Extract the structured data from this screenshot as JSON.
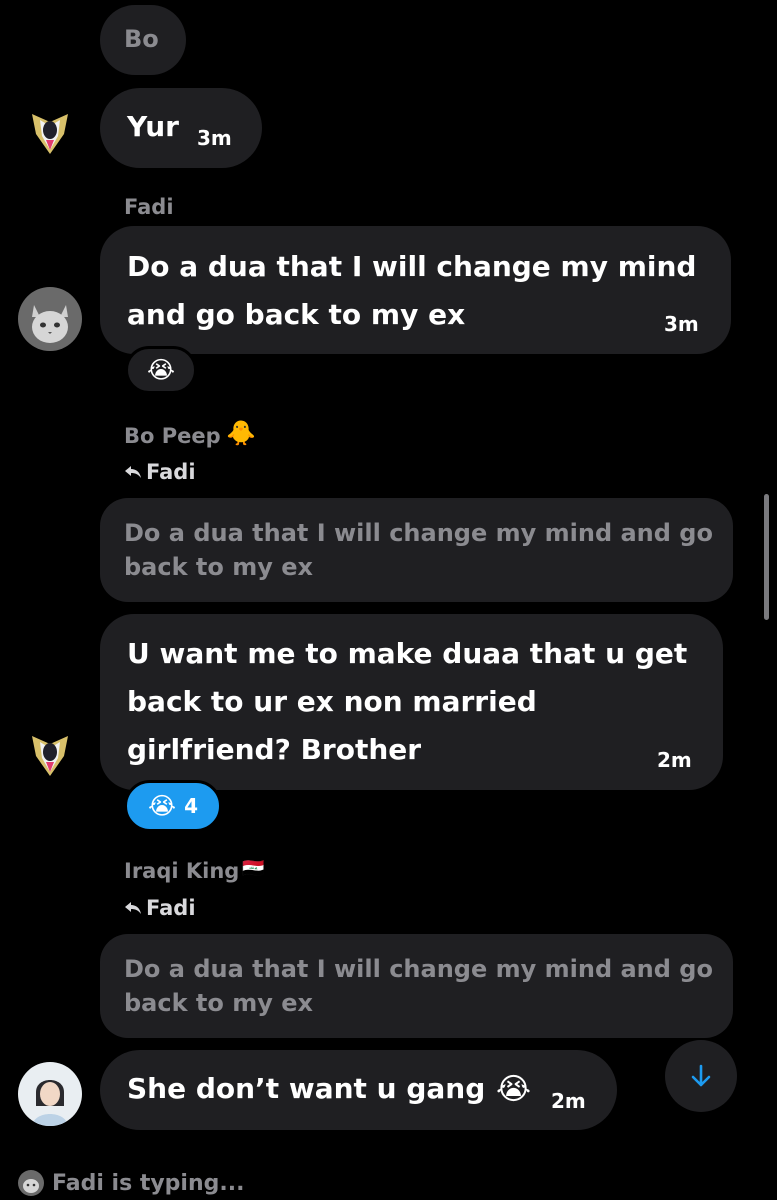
{
  "messages": {
    "bo_top": {
      "text": "Bo"
    },
    "yur": {
      "text": "Yur",
      "time": "3m"
    },
    "fadi": {
      "sender": "Fadi",
      "text": "Do a dua that I will change my mind\nand go back to my ex",
      "time": "3m",
      "reaction_emoji": "😭"
    },
    "bopeep": {
      "sender": "Bo Peep",
      "sender_emoji": "🐥",
      "reply_icon": "reply-arrow-icon",
      "reply_to": "Fadi",
      "quote": "Do a dua that I will change my mind and go\nback to my ex",
      "text": "U want me to make duaa that u get\nback to ur ex non married\ngirlfriend? Brother",
      "time": "2m",
      "reaction_emoji": "😭",
      "reaction_count": "4"
    },
    "iraqi": {
      "sender": "Iraqi King",
      "sender_emoji": "🇮🇶",
      "reply_icon": "reply-arrow-icon",
      "reply_to": "Fadi",
      "quote": "Do a dua that I will change my mind and go\nback to my ex",
      "text": "She don’t want u gang",
      "text_emoji": "😭",
      "time": "2m"
    }
  },
  "typing": {
    "text": "Fadi is typing..."
  },
  "scroll_down": {
    "icon": "arrow-down-icon"
  },
  "colors": {
    "background": "#000000",
    "bubble": "#1f1f22",
    "reaction_active": "#1d9bf0",
    "muted_text": "#8b8b90"
  }
}
